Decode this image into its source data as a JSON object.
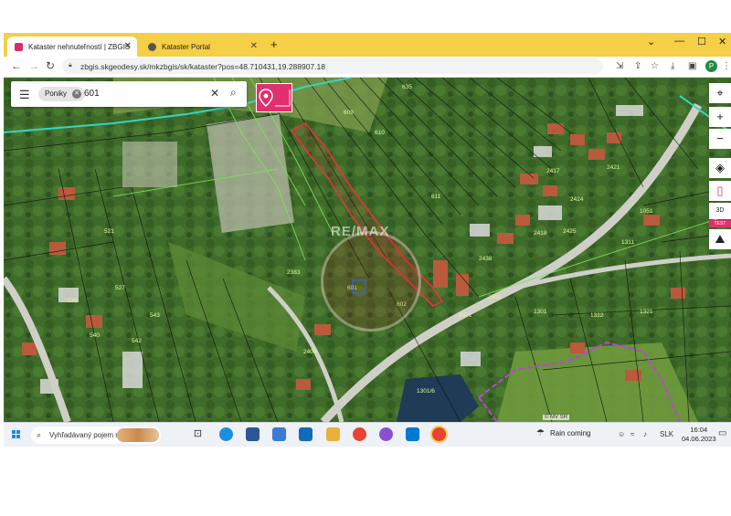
{
  "browser": {
    "tabs": [
      {
        "title": "Kataster nehnuteľností | ZBGIS",
        "active": true,
        "favicon_color": "#d92b6a"
      },
      {
        "title": "Kataster Portal",
        "active": false,
        "favicon_color": "#555555"
      }
    ],
    "new_tab": "+",
    "url": "zbgis.skgeodesy.sk/mkzbgis/sk/kataster?pos=48.710431,19.288907.18",
    "profile_initial": "P",
    "chrome_color": "#f5cf45"
  },
  "map": {
    "search": {
      "chip_label": "Poniky",
      "query": "601"
    },
    "tools": {
      "layers_badge": "3D",
      "test_badge": "TEST"
    },
    "parcel_labels": [
      "635",
      "609",
      "610",
      "611",
      "601",
      "602",
      "1051",
      "1311",
      "1321",
      "1322",
      "521",
      "527",
      "540",
      "542",
      "543",
      "539",
      "1301",
      "1301/6",
      "2383",
      "2404",
      "2417",
      "2418",
      "2424",
      "2425",
      "2421",
      "2438",
      "2471",
      "2502"
    ],
    "watermark": "RE/MAX",
    "credit": "© MV SR",
    "highlight_color": "#e8333a"
  },
  "taskbar": {
    "search_placeholder": "Vyhľadávaný pojem na...",
    "weather": "Rain coming",
    "language": "SLK",
    "time": "16:04",
    "date": "04.06.2023"
  }
}
